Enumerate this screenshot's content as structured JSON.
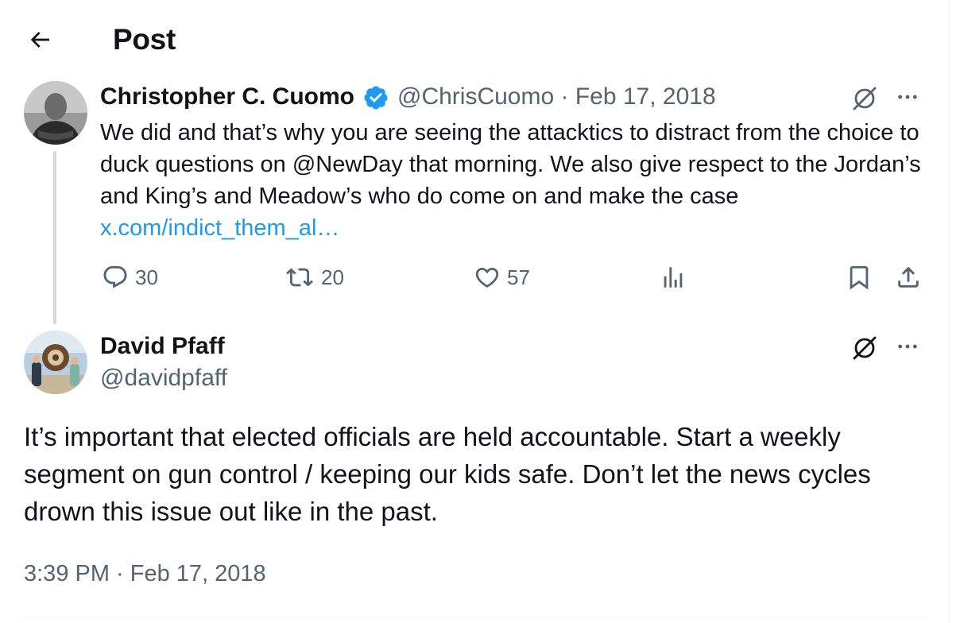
{
  "header": {
    "title": "Post"
  },
  "parent_post": {
    "author_name": "Christopher C. Cuomo",
    "handle_date": "@ChrisCuomo · Feb 17, 2018",
    "text_before_link": "We did and that’s why you are seeing the attacktics to distract from the choice to duck questions on @NewDay that morning. We also give respect to the Jordan’s and King’s and Meadow’s who do come on and make the case ",
    "link_text": "x.com/indict_them_al…",
    "actions": {
      "replies": "30",
      "reposts": "20",
      "likes": "57"
    }
  },
  "main_post": {
    "author_name": "David Pfaff",
    "handle": "@davidpfaff",
    "text": "It’s important that elected officials are held accountable. Start a weekly segment on gun control / keeping our kids safe. Don’t let the news cycles drown this issue out like in the past.",
    "timestamp": "3:39 PM · Feb 17, 2018"
  },
  "colors": {
    "link": "#1d9bf0",
    "verified": "#1d9bf0",
    "secondary": "#536471",
    "thread_line": "#cfd9de"
  },
  "icons": [
    "back-arrow-icon",
    "verified-badge-icon",
    "grok-icon",
    "more-icon",
    "reply-icon",
    "repost-icon",
    "like-icon",
    "views-icon",
    "bookmark-icon",
    "share-icon"
  ]
}
